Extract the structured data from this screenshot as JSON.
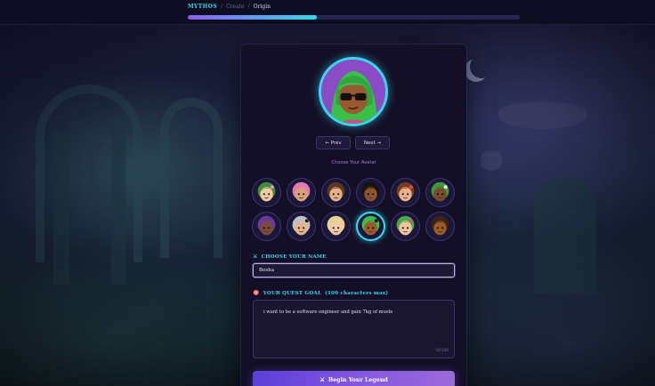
{
  "breadcrumb": {
    "brand": "MYTHOS",
    "step_prev": "Create",
    "step_current": "Origin",
    "separator": "/"
  },
  "progress": {
    "value": 0.39,
    "colors": [
      "#8b5cf6",
      "#38d7ef"
    ]
  },
  "avatar_picker": {
    "prev_label": "← Prev",
    "next_label": "Next →",
    "caption": "Choose Your Avatar",
    "selected_index": 9,
    "avatars": [
      {
        "name": "flower-crown-avatar",
        "skin": "#f2c9a3",
        "hair": "#3f8f3a",
        "accent": "#f28cc4"
      },
      {
        "name": "pink-curly-avatar",
        "skin": "#d8a07a",
        "hair": "#e07ab0",
        "accent": "#e07ab0"
      },
      {
        "name": "brown-hair-boy-avatar",
        "skin": "#e3b08a",
        "hair": "#5a3620",
        "accent": "#5a3620"
      },
      {
        "name": "dark-skin-smiling-avatar",
        "skin": "#8a5530",
        "hair": "#1a1210",
        "accent": "#1a1210"
      },
      {
        "name": "red-flower-girl-avatar",
        "skin": "#e8b28e",
        "hair": "#7a3a1e",
        "accent": "#e04a4a"
      },
      {
        "name": "green-dreadlocks-avatar",
        "skin": "#7a4a2a",
        "hair": "#3c9a3c",
        "accent": "#f2f2f2"
      },
      {
        "name": "purple-hair-avatar",
        "skin": "#7a4a3a",
        "hair": "#6a3a9a",
        "accent": "#6a3a9a"
      },
      {
        "name": "grey-hair-sunglasses-avatar",
        "skin": "#e2b58c",
        "hair": "#c0c0c8",
        "accent": "#202020"
      },
      {
        "name": "blonde-hair-avatar",
        "skin": "#f0c9a6",
        "hair": "#e8d090",
        "accent": "#e8d090"
      },
      {
        "name": "green-hair-sunglasses-avatar",
        "skin": "#9a5a30",
        "hair": "#3ac04a",
        "accent": "#111111"
      },
      {
        "name": "green-leaf-hair-avatar",
        "skin": "#f0c4a0",
        "hair": "#4aa84a",
        "accent": "#e84a7a"
      },
      {
        "name": "brown-skin-short-hair-avatar",
        "skin": "#9a5a2a",
        "hair": "#3a2214",
        "accent": "#3a2214"
      }
    ]
  },
  "name_field": {
    "icon": "⚔",
    "label": "CHOOSE YOUR NAME",
    "value": "Bosha"
  },
  "goal_field": {
    "icon": "🎯",
    "label": "YOUR QUEST GOAL",
    "sublabel": "(100 characters max)",
    "value": "i want to be a software engineer and gain 7kg of musle",
    "count": "54/100"
  },
  "submit": {
    "icon": "⚔",
    "label": "Begin Your Legend"
  },
  "colors": {
    "accent_cyan": "#38d7ef",
    "accent_purple": "#8b5cf6",
    "card_bg": "#130f26",
    "main_avatar_bg": "#8c4bc6"
  }
}
